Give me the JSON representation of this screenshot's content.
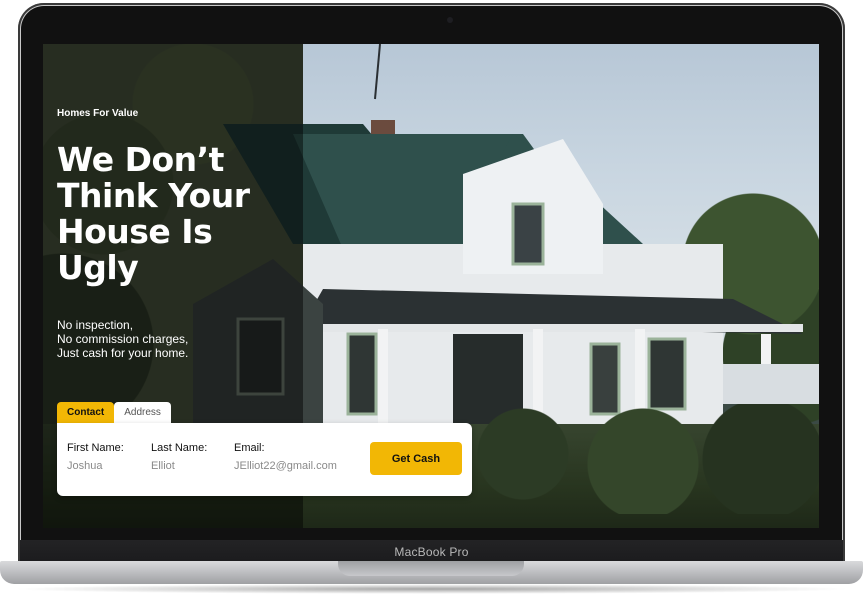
{
  "device": {
    "label": "MacBook Pro"
  },
  "hero": {
    "brand": "Homes For Value",
    "headline": [
      "We Don’t",
      "Think Your",
      "House Is",
      "Ugly"
    ],
    "subtext": [
      "No inspection,",
      "No commission charges,",
      "Just cash for your home."
    ]
  },
  "form": {
    "tabs": [
      {
        "label": "Contact",
        "active": true
      },
      {
        "label": "Address",
        "active": false
      }
    ],
    "fields": [
      {
        "label": "First Name:",
        "value": "Joshua"
      },
      {
        "label": "Last Name:",
        "value": "Elliot"
      },
      {
        "label": "Email:",
        "value": "JElliot22@gmail.com"
      }
    ],
    "submit_label": "Get Cash"
  },
  "colors": {
    "accent": "#f2b705"
  }
}
